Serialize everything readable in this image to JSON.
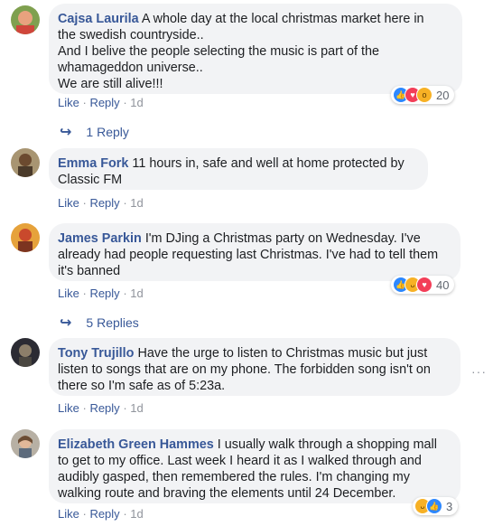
{
  "comments": [
    {
      "author": "Cajsa Laurila",
      "lines": [
        "A whole day at the local christmas market here in",
        "the swedish countryside..",
        "And I belive the people selecting the music is part of the",
        "whamageddon universe..",
        "We are still alive!!!"
      ],
      "like": "Like",
      "reply": "Reply",
      "time": "1d",
      "reactions": {
        "icons": [
          "like-icon",
          "love-icon",
          "wow-icon"
        ],
        "count": "20"
      },
      "replies": "1 Reply"
    },
    {
      "author": "Emma Fork",
      "lines": [
        "11 hours in, safe and well at home protected by",
        "Classic FM"
      ],
      "like": "Like",
      "reply": "Reply",
      "time": "1d"
    },
    {
      "author": "James Parkin",
      "lines": [
        "I'm DJing a Christmas party on Wednesday. I've",
        "already had people requesting last Christmas. I've had to tell them",
        "it's banned"
      ],
      "like": "Like",
      "reply": "Reply",
      "time": "1d",
      "reactions": {
        "icons": [
          "like-icon",
          "haha-icon",
          "love-icon"
        ],
        "count": "40"
      },
      "replies": "5 Replies"
    },
    {
      "author": "Tony Trujillo",
      "lines": [
        "Have the urge to listen to Christmas music but just",
        "listen to songs that are on my phone. The forbidden song isn't on",
        "there so I'm safe as of 5:23a."
      ],
      "like": "Like",
      "reply": "Reply",
      "time": "1d",
      "more": "···"
    },
    {
      "author": "Elizabeth Green Hammes",
      "lines": [
        "I usually walk through a shopping mall",
        "to get to my office. Last week I heard it as I walked through and",
        "audibly gasped, then remembered the rules. I'm changing my",
        "walking route and braving the elements until 24 December."
      ],
      "like": "Like",
      "reply": "Reply",
      "time": "1d",
      "reactions": {
        "icons": [
          "haha-icon",
          "like-icon"
        ],
        "count": "3"
      }
    }
  ],
  "colors": {
    "link": "#385898",
    "bubble": "#f2f3f5",
    "meta": "#90949c"
  }
}
